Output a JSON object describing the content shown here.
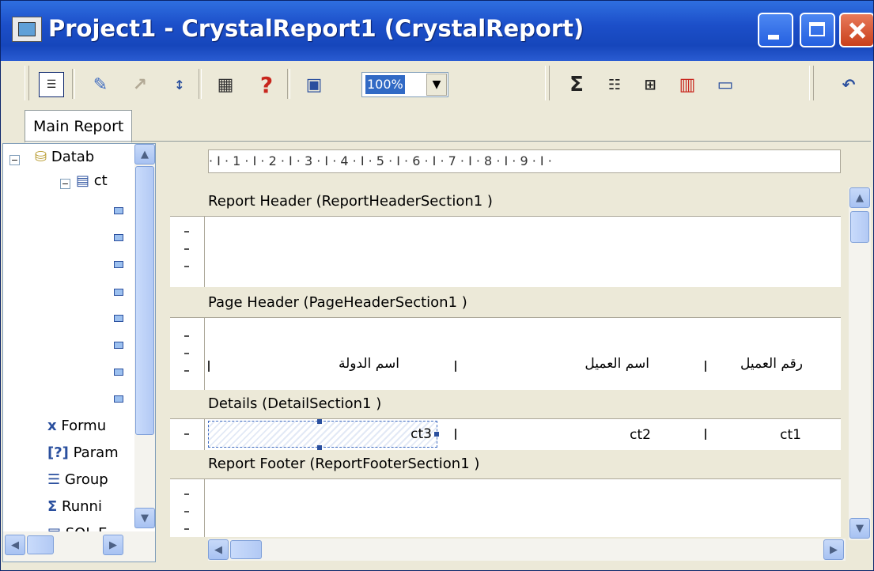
{
  "window": {
    "title": "Project1 - CrystalReport1 (CrystalReport)"
  },
  "toolbar": {
    "zoom_value": "100%",
    "help_glyph": "?",
    "sum_glyph": "Σ"
  },
  "tab": {
    "main_report": "Main Report"
  },
  "tree": {
    "database": "Datab",
    "table": "ct",
    "formula": "Formu",
    "param": "Param",
    "group": "Group",
    "running": "Runni",
    "sql": "SQL E"
  },
  "ruler": {
    "text": "· I · 1 · I · 2 · I · 3 · I · 4 · I · 5 · I · 6 · I · 7 · I · 8 · I · 9 · I ·"
  },
  "sections": {
    "report_header": "Report Header  (ReportHeaderSection1 )",
    "page_header": "Page Header  (PageHeaderSection1 )",
    "details": "Details  (DetailSection1 )",
    "report_footer": "Report Footer  (ReportFooterSection1 )"
  },
  "page_header_fields": {
    "country_name": "اسم الدولة",
    "customer_name": "اسم العميل",
    "customer_number": "رقم العميل"
  },
  "detail_fields": {
    "ct3": "ct3",
    "ct2": "ct2",
    "ct1": "ct1"
  }
}
